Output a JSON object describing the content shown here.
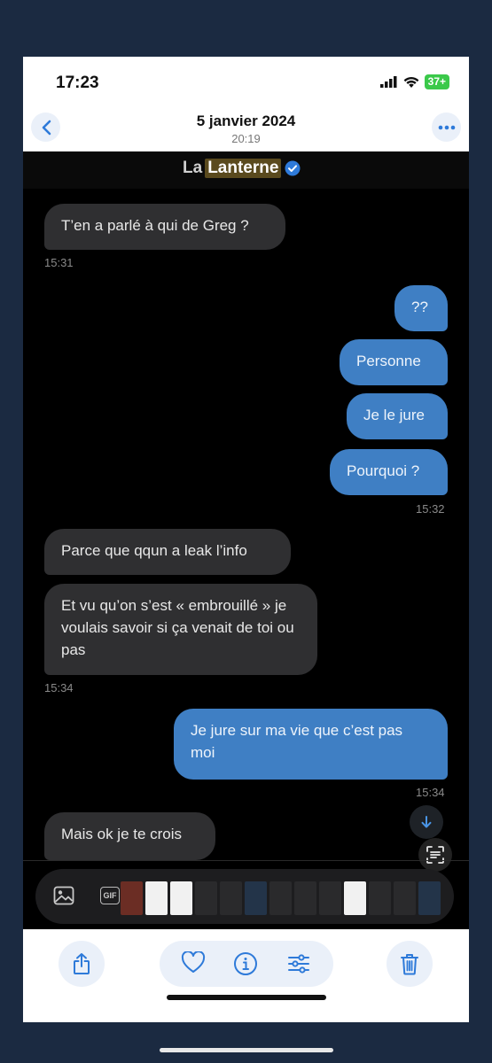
{
  "status": {
    "time": "17:23",
    "battery": "37+"
  },
  "nav": {
    "title": "5 janvier 2024",
    "subtitle": "20:19"
  },
  "chat_header": {
    "la": "La",
    "lanterne": "Lanterne"
  },
  "messages": [
    {
      "dir": "in",
      "text": "T’en a parlé à qui de Greg ?"
    },
    {
      "dir": "out",
      "text": "??"
    },
    {
      "dir": "out",
      "text": "Personne"
    },
    {
      "dir": "out",
      "text": "Je le jure"
    },
    {
      "dir": "out",
      "text": "Pourquoi ?"
    },
    {
      "dir": "in",
      "text": "Parce que qqun a leak l’info"
    },
    {
      "dir": "in",
      "text": "Et vu qu’on s’est « embrouillé » je voulais savoir si ça venait de toi ou pas"
    },
    {
      "dir": "out",
      "text": "Je jure sur ma vie que c’est pas moi"
    },
    {
      "dir": "in",
      "text": "Mais ok je te crois"
    }
  ],
  "timestamps": [
    "15:31",
    "15:32",
    "15:34",
    "15:34"
  ],
  "composer": {
    "gif_label": "GIF"
  },
  "icons": {
    "back": "chevron-left-icon",
    "more": "ellipsis-icon",
    "verified": "verified-badge-icon",
    "scroll_down": "arrow-down-icon",
    "text_scan": "live-text-icon",
    "image": "image-icon",
    "share": "share-icon",
    "favorite": "heart-icon",
    "info": "info-icon",
    "adjust": "sliders-icon",
    "delete": "trash-icon"
  },
  "colors": {
    "accent": "#3f7fc4",
    "incoming": "#2f2f31",
    "ios_blue": "#2e7ad9",
    "background": "#1b2a41"
  }
}
